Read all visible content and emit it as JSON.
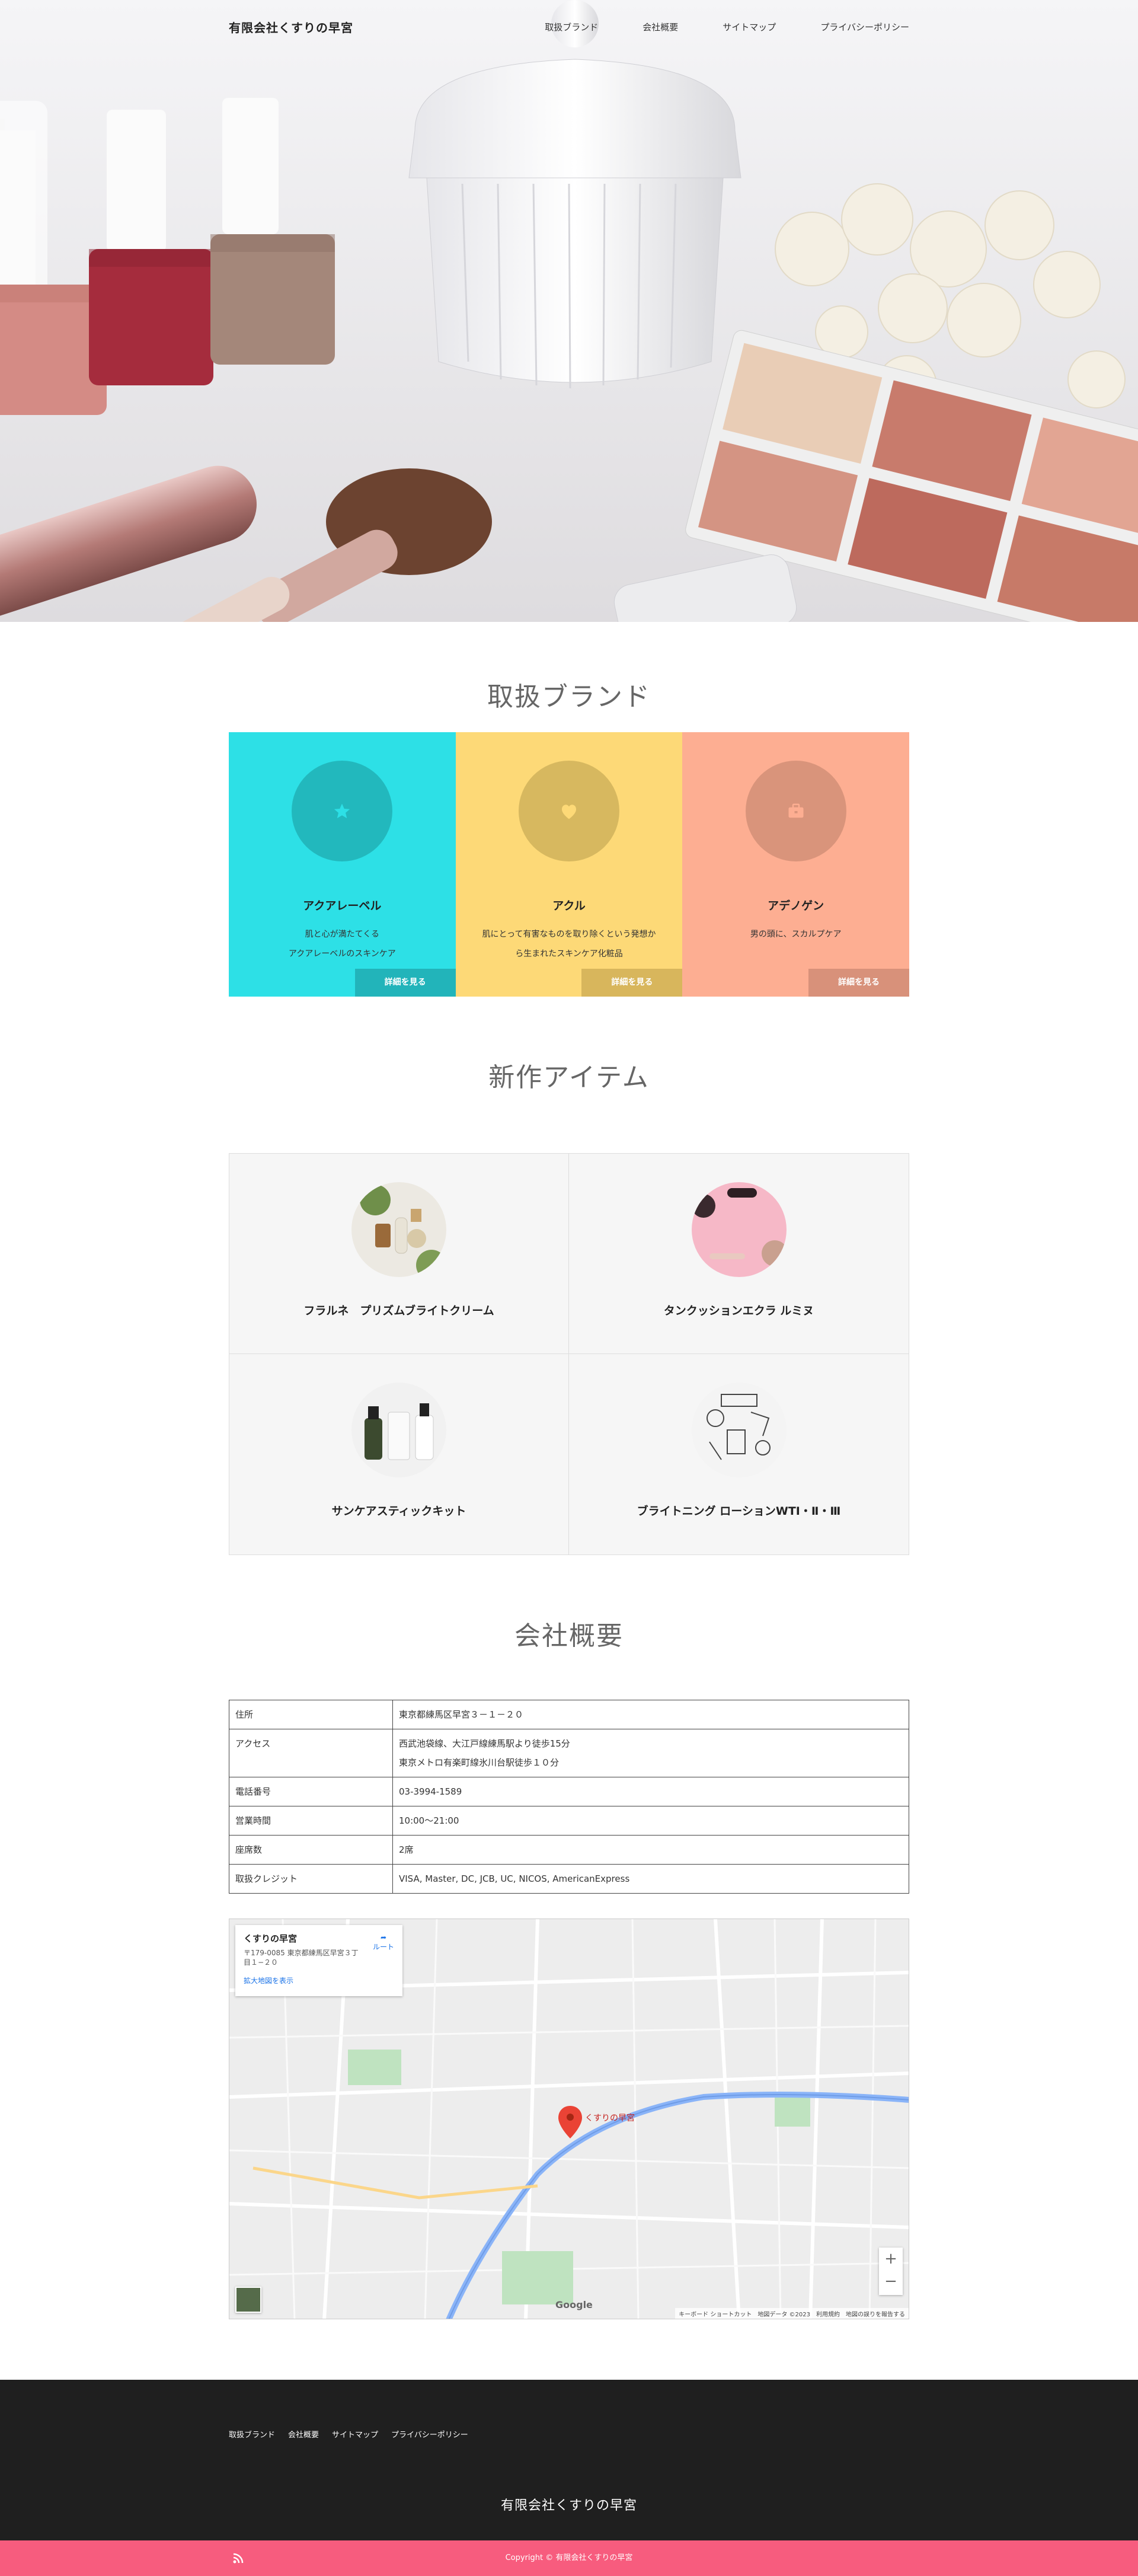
{
  "site": {
    "name": "有限会社くすりの早宮"
  },
  "nav": [
    {
      "label": "取扱ブランド"
    },
    {
      "label": "会社概要"
    },
    {
      "label": "サイトマップ"
    },
    {
      "label": "プライバシーポリシー"
    }
  ],
  "brands": {
    "title": "取扱ブランド",
    "items": [
      {
        "name": "アクアレーベル",
        "desc1": "肌と心が満たてくる",
        "desc2": "アクアレーベルのスキンケア",
        "more": "詳細を見る",
        "bg": "#2de0e6",
        "circle": "#22b8bd",
        "btn": "#22b4ba",
        "icon": "star-icon"
      },
      {
        "name": "アクル",
        "desc1": "肌にとって有害なものを取り除くという発想か",
        "desc2": "ら生まれたスキンケア化粧品",
        "more": "詳細を見る",
        "bg": "#fdd977",
        "circle": "#d7b85f",
        "btn": "#d8b65c",
        "icon": "heart-icon"
      },
      {
        "name": "アデノゲン",
        "desc1": "男の頭に、スカルプケア",
        "desc2": "",
        "more": "詳細を見る",
        "bg": "#fdae92",
        "circle": "#d9947b",
        "btn": "#d8917a",
        "icon": "briefcase-icon"
      }
    ]
  },
  "new_items": {
    "title": "新作アイテム",
    "items": [
      {
        "name": "フラルネ　プリズムブライトクリーム"
      },
      {
        "name": "タンクッションエクラ ルミヌ"
      },
      {
        "name": "サンケアスティックキット"
      },
      {
        "name": "ブライトニング ローションWTⅠ・Ⅱ・Ⅲ"
      }
    ]
  },
  "company": {
    "title": "会社概要",
    "rows": [
      {
        "key": "住所",
        "value": "東京都練馬区早宮３－１－２０",
        "value2": ""
      },
      {
        "key": "アクセス",
        "value": "西武池袋線、大江戸線練馬駅より徒歩15分",
        "value2": "東京メトロ有楽町線氷川台駅徒歩１０分"
      },
      {
        "key": "電話番号",
        "value": "03-3994-1589",
        "value2": ""
      },
      {
        "key": "営業時間",
        "value": "10:00～21:00",
        "value2": ""
      },
      {
        "key": "座席数",
        "value": "2席",
        "value2": ""
      },
      {
        "key": "取扱クレジット",
        "value": "VISA, Master, DC, JCB, UC, NICOS, AmericanExpress",
        "value2": ""
      }
    ]
  },
  "map": {
    "place": "くすりの早宮",
    "address": "〒179-0085 東京都練馬区早宮３丁目１−２０",
    "enlarge": "拡大地図を表示",
    "route": "ルート",
    "pin_label": "くすりの早宮",
    "footer": "キーボード ショートカット　地図データ ©2023　利用規約　地図の誤りを報告する",
    "google": "Google"
  },
  "footer": {
    "nav": [
      {
        "label": "取扱ブランド"
      },
      {
        "label": "会社概要"
      },
      {
        "label": "サイトマップ"
      },
      {
        "label": "プライバシーポリシー"
      }
    ],
    "name": "有限会社くすりの早宮",
    "copyright": "Copyright ©  有限会社くすりの早宮"
  }
}
